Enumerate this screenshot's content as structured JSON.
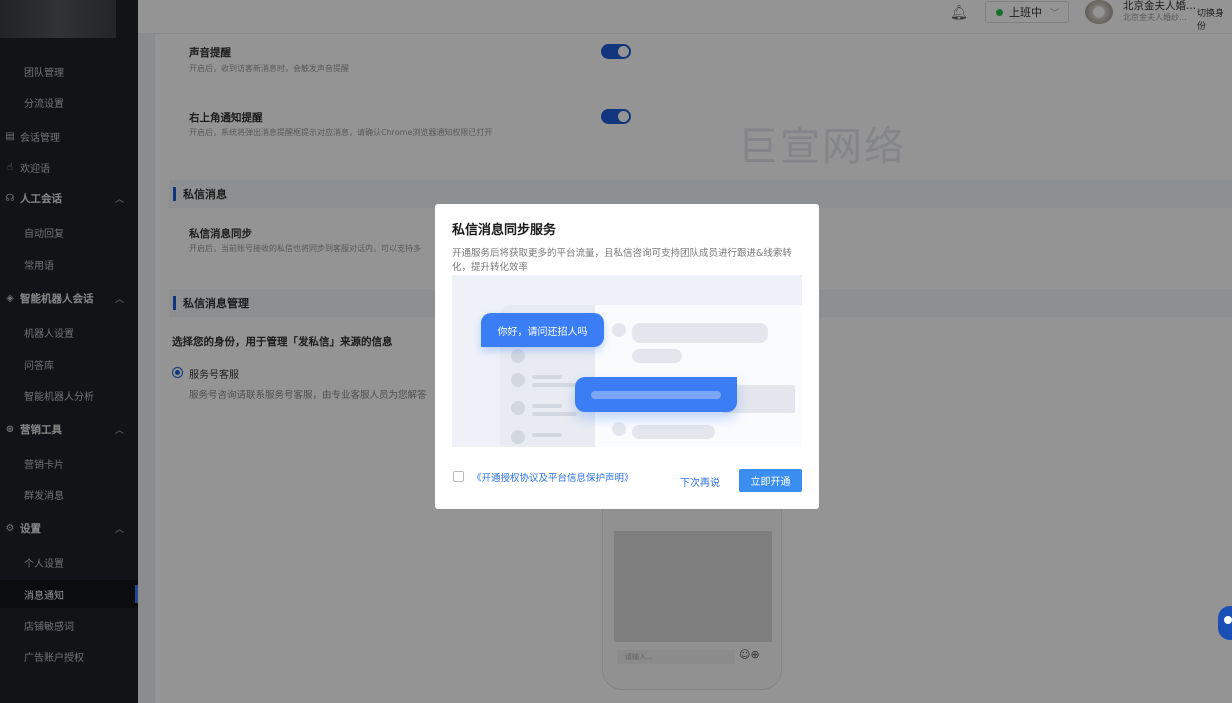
{
  "sidebar": {
    "items": [
      {
        "label": "团队管理"
      },
      {
        "label": "分流设置"
      },
      {
        "label": "会话管理"
      },
      {
        "label": "欢迎语"
      },
      {
        "label": "人工会话"
      },
      {
        "label": "自动回复"
      },
      {
        "label": "常用语"
      },
      {
        "label": "智能机器人会话"
      },
      {
        "label": "机器人设置"
      },
      {
        "label": "问答库"
      },
      {
        "label": "智能机器人分析"
      },
      {
        "label": "营销工具"
      },
      {
        "label": "营销卡片"
      },
      {
        "label": "群发消息"
      },
      {
        "label": "设置"
      },
      {
        "label": "个人设置"
      },
      {
        "label": "消息通知"
      },
      {
        "label": "店铺敏感词"
      },
      {
        "label": "广告账户授权"
      }
    ]
  },
  "header": {
    "status_label": "上班中",
    "account_name": "北京金夫人婚...",
    "account_sub": "北京金夫人婚纱...",
    "switch_label": "切换身份"
  },
  "main": {
    "watermark": "巨宣网络",
    "sound_title": "声音提醒",
    "sound_desc": "开启后，收到访客新消息时，会触发声音提醒",
    "notify_title": "右上角通知提醒",
    "notify_desc": "开启后，系统将弹出消息提醒框提示对应消息，请确认Chrome浏览器通知权限已打开",
    "section_dm": "私信消息",
    "dm_sync_title": "私信消息同步",
    "dm_sync_desc": "开启后，当前账号接收的私信也将同步到客服对话内，可以支持多",
    "section_dm_manage": "私信消息管理",
    "identity_prompt": "选择您的身份，用于管理「发私信」来源的信息",
    "radio_label": "服务号客服",
    "radio_desc": "服务号咨询请联系服务号客服，由专业客服人员为您解答",
    "phone_input_placeholder": "请输入..."
  },
  "modal": {
    "title": "私信消息同步服务",
    "desc": "开通服务后将获取更多的平台流量，且私信咨询可支持团队成员进行跟进&线索转化，提升转化效率",
    "bubble_text": "你好，请问还招人吗",
    "agreement": "《开通授权协议及平台信息保护声明》",
    "later": "下次再说",
    "open": "立即开通"
  },
  "colors": {
    "primary": "#3a8ef0",
    "toggle": "#1e5ed8",
    "sidebar_bg": "#1f2229"
  }
}
